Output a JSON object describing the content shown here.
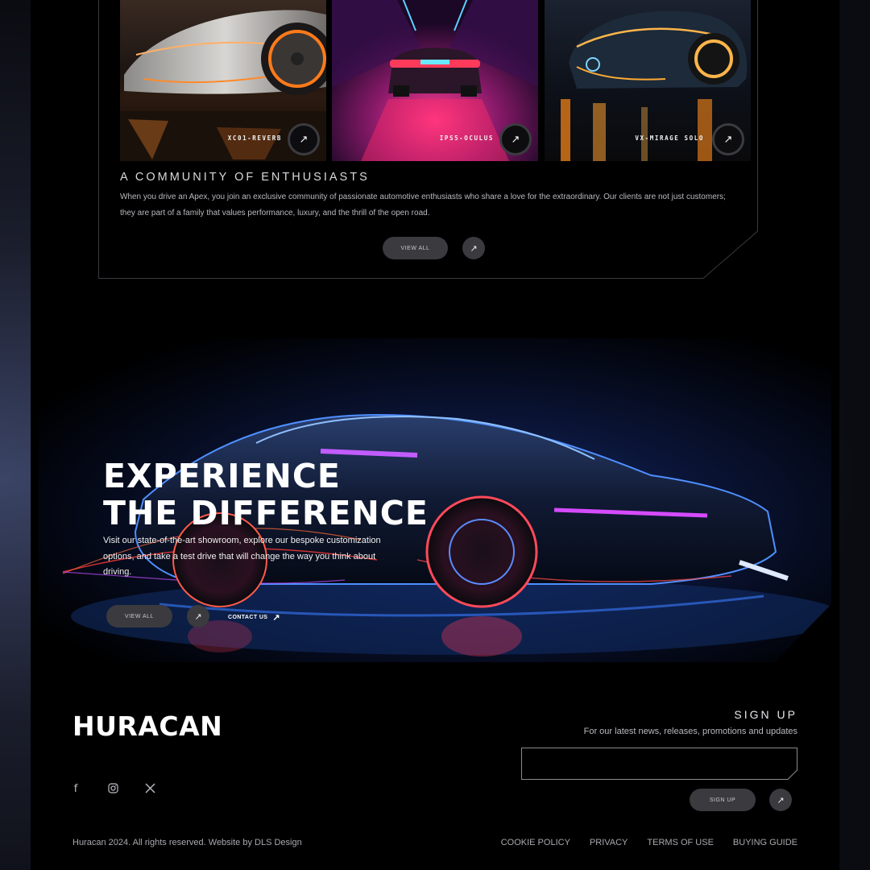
{
  "gallery": {
    "cards": [
      {
        "label": "XC01-REVERB"
      },
      {
        "label": "IPS5-OCULUS"
      },
      {
        "label": "VX-MIRAGE SOLO"
      }
    ],
    "heading": "A COMMUNITY OF ENTHUSIASTS",
    "body": "When you drive an Apex, you join an exclusive community of passionate automotive enthusiasts who share a love for the extraordinary. Our clients are not just customers; they are part of a family that values performance, luxury, and the thrill of the open road.",
    "view_all": "VIEW ALL"
  },
  "hero": {
    "title": "EXPERIENCE\nTHE DIFFERENCE",
    "body": "Visit our state-of-the-art showroom, explore our bespoke customization options, and take a test drive that will change the way you think about driving.",
    "view_all": "VIEW ALL",
    "contact": "CONTACT US"
  },
  "footer": {
    "logo": "HURACAN",
    "socials": [
      "facebook",
      "instagram",
      "x"
    ],
    "signup_title": "SIGN UP",
    "signup_sub": "For our latest news, releases, promotions and updates",
    "signup_button": "SIGN UP",
    "copyright": "Huracan 2024. All rights reserved. Website by DLS Design",
    "links": [
      "COOKIE POLICY",
      "PRIVACY",
      "TERMS OF USE",
      "BUYING GUIDE"
    ]
  },
  "icons": {
    "arrow": "↗"
  },
  "colors": {
    "page_bg": "#000000",
    "pill_bg": "#3a3a3f",
    "neon_blue": "#2f6bff",
    "neon_pink": "#d23bff",
    "neon_orange": "#ff7a1a"
  }
}
